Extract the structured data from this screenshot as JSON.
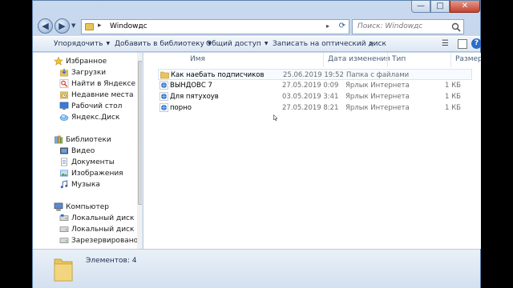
{
  "window": {
    "controls": {
      "minimize": "—",
      "maximize": "□",
      "close": "✕"
    }
  },
  "nav": {
    "back": "◀",
    "forward": "▶",
    "address_sep": "▸",
    "address_path": "Windowдс",
    "address_tail": "▸",
    "search_placeholder": "Поиск: Windowдс"
  },
  "commandbar": {
    "organize": "Упорядочить",
    "add_library": "Добавить в библиотеку",
    "share": "Общий доступ",
    "burn": "Записать на оптический диск",
    "more": "»",
    "help": "?"
  },
  "sidebar": {
    "favorites_title": "Избранное",
    "favorites": [
      "Загрузки",
      "Найти в Яндексе",
      "Недавние места",
      "Рабочий стол",
      "Яндекс.Диск"
    ],
    "libraries_title": "Библиотеки",
    "libraries": [
      "Видео",
      "Документы",
      "Изображения",
      "Музыка"
    ],
    "computer_title": "Компьютер",
    "computer": [
      "Локальный диск (C:)",
      "Локальный диск (D:)",
      "Зарезервировано систе"
    ]
  },
  "columns": {
    "name": "Имя",
    "date": "Дата изменения",
    "type": "Тип",
    "size": "Размер"
  },
  "files": [
    {
      "name": "Как наебать подписчиков",
      "date": "25.06.2019 19:52",
      "type": "Папка с файлами",
      "size": "",
      "icon": "folder-icon"
    },
    {
      "name": "ВЫНДОВС 7",
      "date": "27.05.2019 0:09",
      "type": "Ярлык Интернета",
      "size": "1 КБ",
      "icon": "internet-shortcut-icon"
    },
    {
      "name": "Для пятухоув",
      "date": "03.05.2019 3:41",
      "type": "Ярлык Интернета",
      "size": "1 КБ",
      "icon": "internet-shortcut-icon"
    },
    {
      "name": "порно",
      "date": "27.05.2019 8:21",
      "type": "Ярлык Интернета",
      "size": "1 КБ",
      "icon": "internet-shortcut-icon"
    }
  ],
  "status": {
    "count_text": "Элементов: 4"
  },
  "colors": {
    "folder": "#e9c45a",
    "accent": "#2c6dc8",
    "close": "#c2432f"
  }
}
